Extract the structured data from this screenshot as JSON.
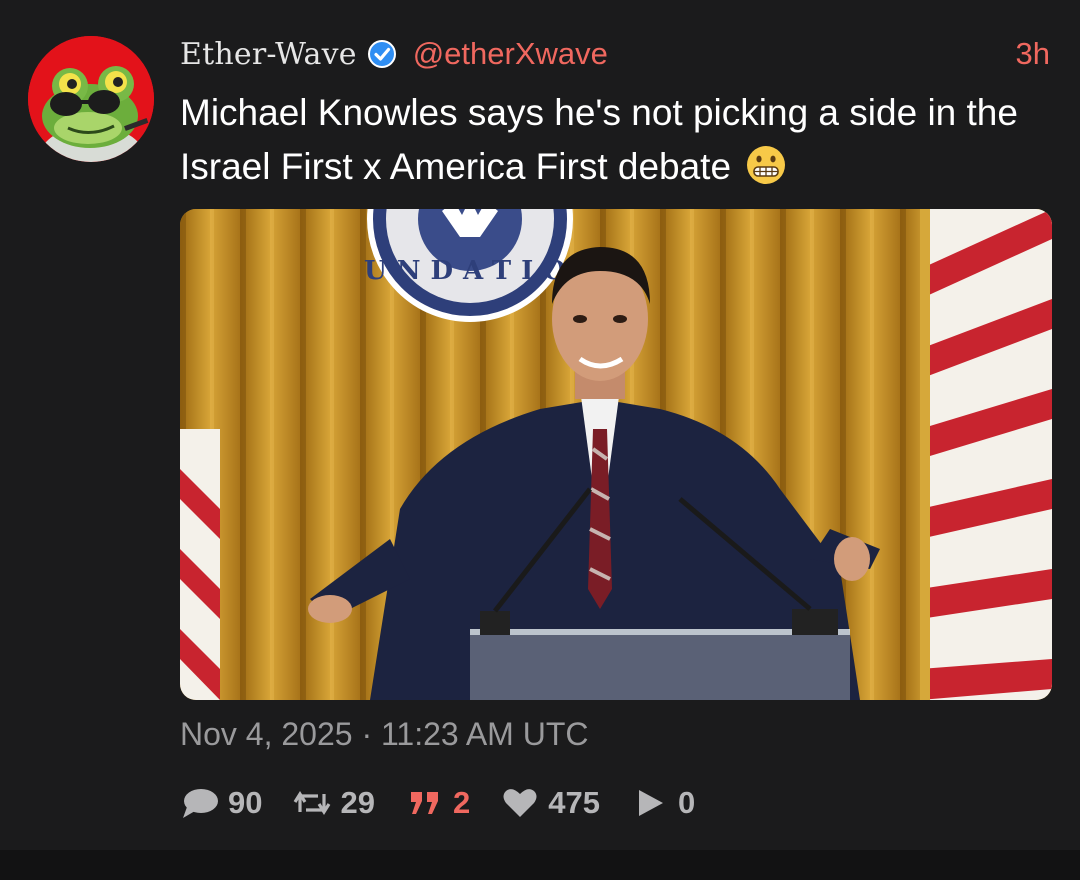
{
  "post": {
    "display_name": "Ether-Wave",
    "handle": "@etherXwave",
    "time_ago": "3h",
    "text": "Michael Knowles says he's not picking a side in the Israel First x America First debate",
    "emoji": "grimacing-face",
    "timestamp": "Nov 4, 2025 · 11:23 AM UTC"
  },
  "media": {
    "seal_text": "UNDATIO"
  },
  "actions": {
    "replies": "90",
    "reposts": "29",
    "quotes": "2",
    "likes": "475",
    "views": "0"
  },
  "colors": {
    "accent": "#f0685f",
    "verified": "#2f8ef3",
    "background": "#1b1b1c",
    "muted": "#9a9a9c"
  }
}
